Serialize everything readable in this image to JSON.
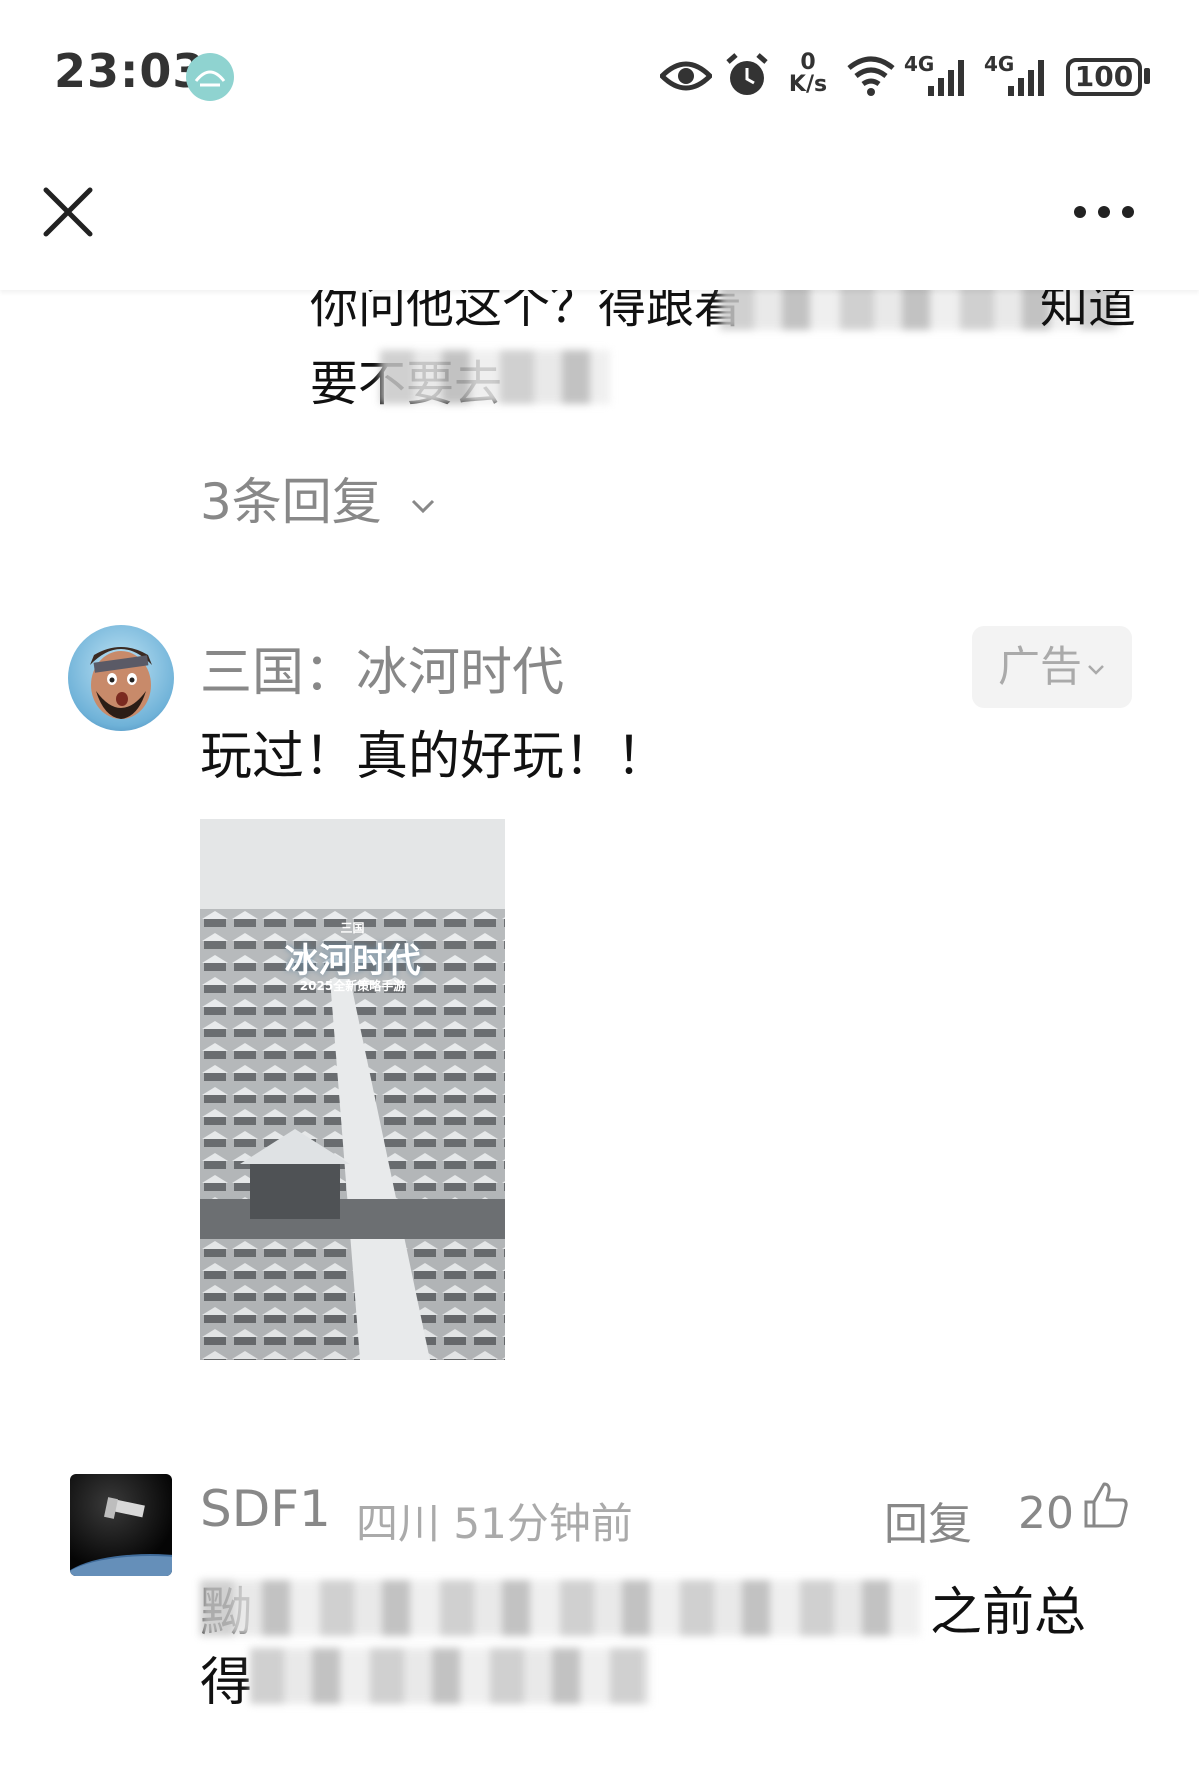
{
  "status_bar": {
    "time": "23:03",
    "net_speed_value": "0",
    "net_speed_unit": "K/s",
    "signal_1_label": "4G",
    "signal_2_label": "4G",
    "battery": "100",
    "icons": [
      "eye-icon",
      "alarm-icon",
      "wifi-icon",
      "signal-icon",
      "battery-icon"
    ]
  },
  "nav": {
    "close_icon": "close-icon",
    "more_icon": "more-icon"
  },
  "prev_comment": {
    "line1_visible": "你问他这个？得跟着",
    "line1_end": "知道",
    "line2_visible": "要不要去"
  },
  "replies_toggle": {
    "label": "3条回复"
  },
  "ad_comment": {
    "name": "三国：冰河时代",
    "badge": "广告",
    "text": "玩过！真的好玩！！",
    "image_title_small": "三国",
    "image_title": "冰河时代",
    "image_subtitle": "2025全新策略手游"
  },
  "user_comment": {
    "name": "SDF1",
    "meta": "四川 51分钟前",
    "reply_label": "回复",
    "like_count": "20",
    "line1_start": "黝",
    "line1_end": "之前总",
    "line2_start": "得"
  },
  "colors": {
    "text_primary": "#111111",
    "text_secondary": "#888888",
    "badge_bg": "#f3f3f3"
  }
}
